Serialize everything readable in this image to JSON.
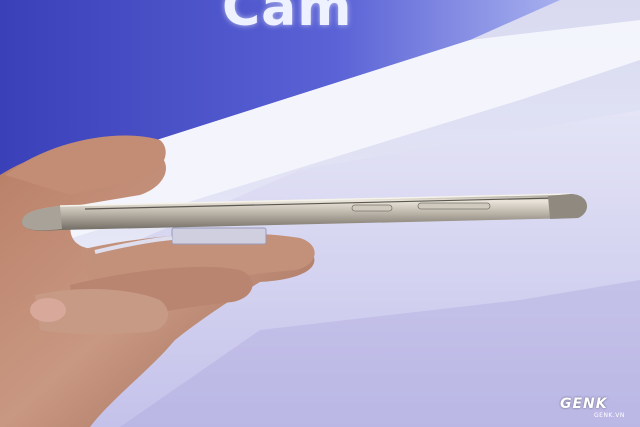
{
  "background": {
    "banner_text": "Cam",
    "colors": {
      "banner": "#4a52c8",
      "wall": "#dcdcf0",
      "table": "#e8e8f8"
    }
  },
  "phone": {
    "colors": {
      "body": "#b8b2a8",
      "highlight": "#ebe6dc",
      "shadow": "#6f6a62"
    }
  },
  "hand": {
    "colors": {
      "skin": "#c7937c",
      "skin_dark": "#8a5a46",
      "skin_light": "#e0b6a2"
    }
  },
  "watermark": {
    "text": "GENK",
    "sub": "GENK.VN"
  }
}
